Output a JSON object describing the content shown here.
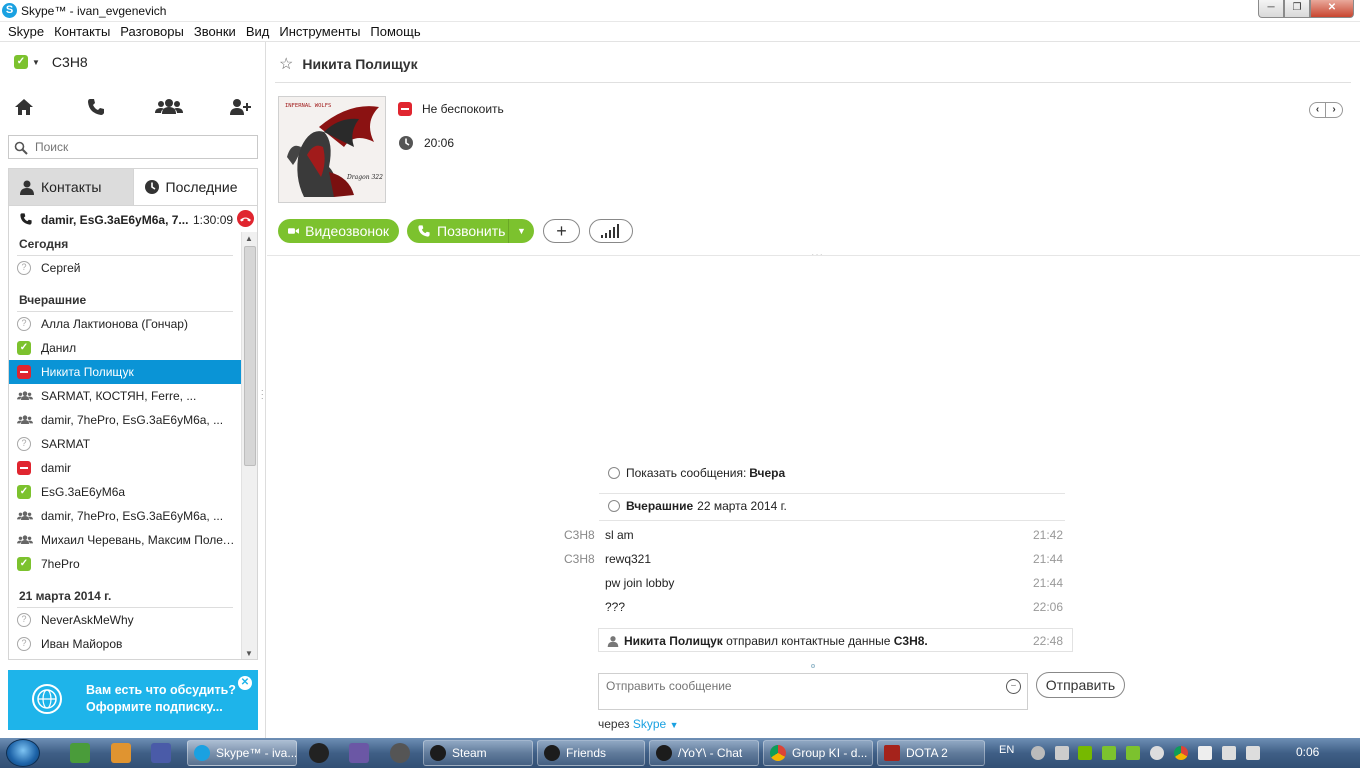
{
  "window": {
    "title": "Skype™ - ivan_evgenevich",
    "icon": "skype-logo-icon"
  },
  "menu": [
    "Skype",
    "Контакты",
    "Разговоры",
    "Звонки",
    "Вид",
    "Инструменты",
    "Помощь"
  ],
  "profile": {
    "name": "C3H8",
    "status_color": "#7cc22e"
  },
  "quickbar": [
    "home-icon",
    "phone-icon",
    "group-icon",
    "add-contact-icon"
  ],
  "search": {
    "placeholder": "Поиск"
  },
  "tabs": {
    "contacts": "Контакты",
    "recent": "Последние"
  },
  "active_call": {
    "name": "damir, EsG.3aE6yM6a, 7...",
    "time": "1:30:09"
  },
  "groups": {
    "today": "Сегодня",
    "yesterday": "Вчерашние",
    "date": "21 марта 2014 г."
  },
  "contacts": [
    {
      "name": "Сергей",
      "status": "away"
    },
    {
      "name": "Алла Лактионова (Гончар)",
      "status": "away"
    },
    {
      "name": "Данил",
      "status": "online"
    },
    {
      "name": "Никита Полищук",
      "status": "dnd"
    },
    {
      "name": "SARMAT, КОСТЯН, Ferre, ...",
      "status": "group"
    },
    {
      "name": "damir, 7hePro, EsG.3aE6yM6a, ...",
      "status": "group"
    },
    {
      "name": "SARMAT",
      "status": "away"
    },
    {
      "name": "damir",
      "status": "dnd"
    },
    {
      "name": "EsG.3aE6yM6a",
      "status": "online"
    },
    {
      "name": "damir, 7hePro, EsG.3aE6yM6a, ...",
      "status": "group"
    },
    {
      "name": "Михаил   Черевань, Максим Полету...",
      "status": "group"
    },
    {
      "name": "7hePro",
      "status": "online"
    },
    {
      "name": "NeverAskMeWhy",
      "status": "away"
    },
    {
      "name": "Иван Майоров",
      "status": "away"
    }
  ],
  "promo": {
    "line1": "Вам есть что обсудить?",
    "line2": "Оформите подписку..."
  },
  "conversation": {
    "contact_name": "Никита Полищук",
    "status_text": "Не беспокоить",
    "local_time": "20:06",
    "avatar_caption_top": "INFERNAL WOLFS",
    "avatar_caption_bottom": "Dragon 322",
    "video_label": "Видеозвонок",
    "call_label": "Позвонить"
  },
  "chat": {
    "show_messages_label": "Показать сообщения:",
    "show_messages_value": "Вчера",
    "date_bold": "Вчерашние",
    "date_rest": "22 марта 2014 г.",
    "messages": [
      {
        "who": "C3H8",
        "text": "sl am",
        "time": "21:42"
      },
      {
        "who": "C3H8",
        "text": "rewq321",
        "time": "21:44"
      },
      {
        "who": "",
        "text": "pw join lobby",
        "time": "21:44"
      },
      {
        "who": "",
        "text": "???",
        "time": "22:06"
      }
    ],
    "contact_card": {
      "sender": "Никита Полищук",
      "middle": "отправил контактные данные",
      "target": "C3H8.",
      "time": "22:48"
    },
    "composer_placeholder": "Отправить сообщение",
    "send_label": "Отправить",
    "via_prefix": "через",
    "via_service": "Skype"
  },
  "taskbar": {
    "tasks": [
      "Skype™ - iva...",
      "Steam",
      "Friends",
      "/YoY\\ - Chat",
      "Group KI - d...",
      "DOTA 2"
    ],
    "lang": "EN",
    "clock": "0:06"
  }
}
